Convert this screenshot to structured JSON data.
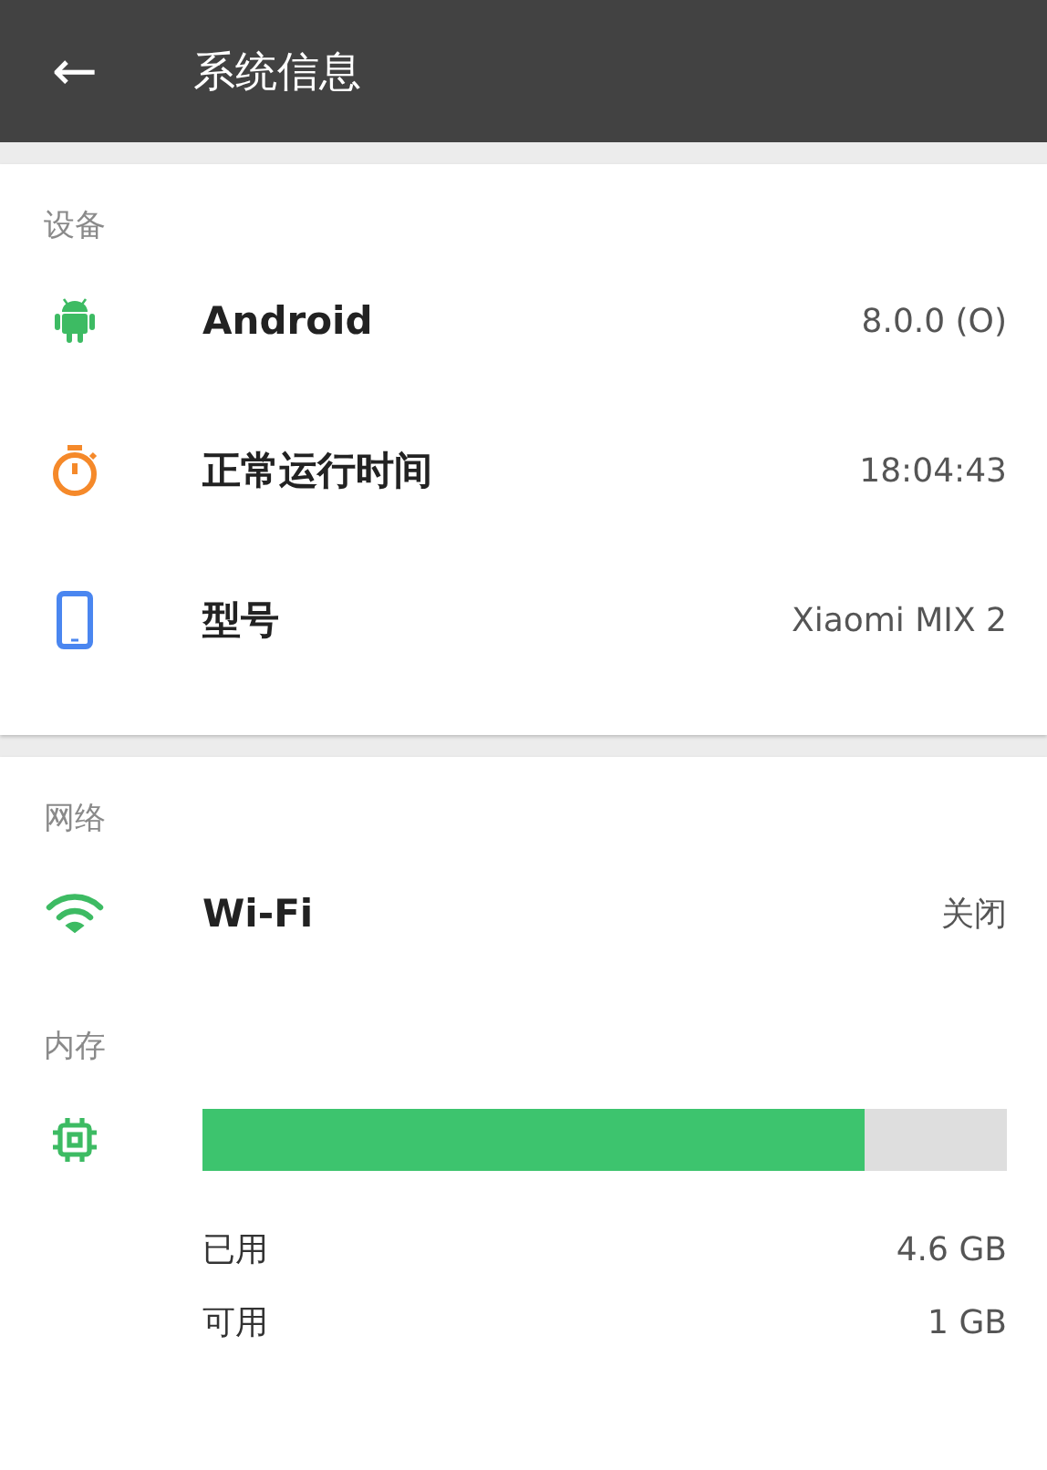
{
  "app_bar": {
    "back_icon": "←",
    "title": "系统信息"
  },
  "device": {
    "header": "设备",
    "rows": [
      {
        "kind": "android",
        "label": "Android",
        "value": "8.0.0 (O)"
      },
      {
        "kind": "timer",
        "label": "正常运行时间",
        "value": "18:04:43"
      },
      {
        "kind": "phone",
        "label": "型号",
        "value": "Xiaomi MIX 2"
      }
    ]
  },
  "network": {
    "header": "网络",
    "rows": [
      {
        "kind": "wifi",
        "label": "Wi-Fi",
        "value": "关闭"
      }
    ]
  },
  "memory": {
    "header": "内存",
    "level": 0.823,
    "stats": [
      {
        "label": "已用",
        "value": "4.6 GB"
      },
      {
        "label": "可用",
        "value": "1 GB"
      }
    ]
  }
}
